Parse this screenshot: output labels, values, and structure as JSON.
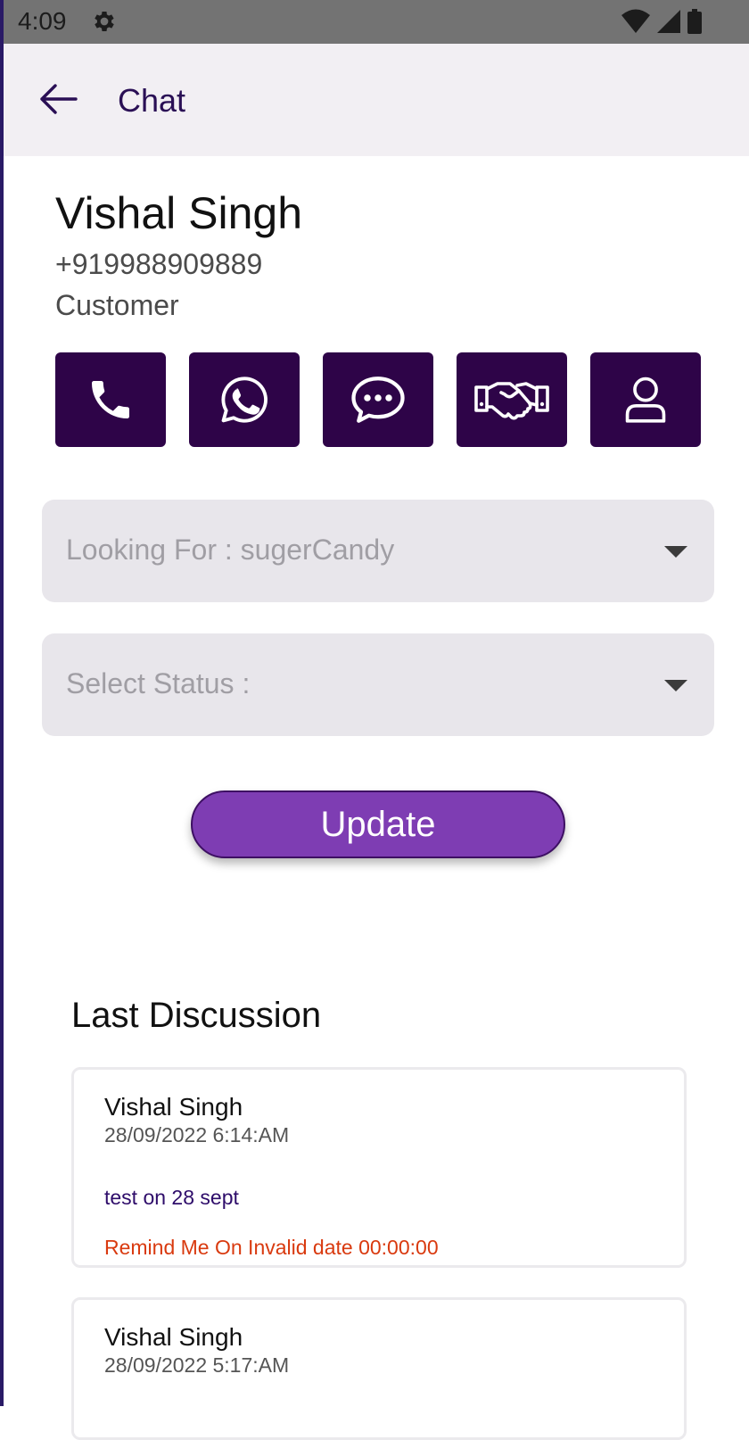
{
  "status_bar": {
    "time": "4:09",
    "icons": [
      "gear-icon",
      "wifi-icon",
      "signal-icon",
      "battery-icon"
    ]
  },
  "app_bar": {
    "title": "Chat",
    "back_icon": "arrow-left-icon"
  },
  "contact": {
    "name": "Vishal Singh",
    "phone": "+919988909889",
    "role": "Customer"
  },
  "actions": [
    {
      "icon": "phone-icon"
    },
    {
      "icon": "whatsapp-icon"
    },
    {
      "icon": "chat-bubble-icon"
    },
    {
      "icon": "handshake-icon"
    },
    {
      "icon": "user-icon"
    }
  ],
  "looking_for": {
    "text": "Looking For : sugerCandy"
  },
  "status_select": {
    "text": "Select Status :"
  },
  "update_label": "Update",
  "discussion": {
    "title": "Last Discussion",
    "items": [
      {
        "name": "Vishal Singh",
        "date": "28/09/2022 6:14:AM",
        "message": "test on 28 sept",
        "reminder": "Remind Me On Invalid date 00:00:00"
      },
      {
        "name": "Vishal Singh",
        "date": "28/09/2022 5:17:AM"
      }
    ]
  },
  "colors": {
    "primary_dark": "#2e0448",
    "accent": "#7e3db3",
    "reminder": "#d93a0f",
    "app_bar_bg": "#f2eff3",
    "dropdown_bg": "#e8e6eb"
  }
}
